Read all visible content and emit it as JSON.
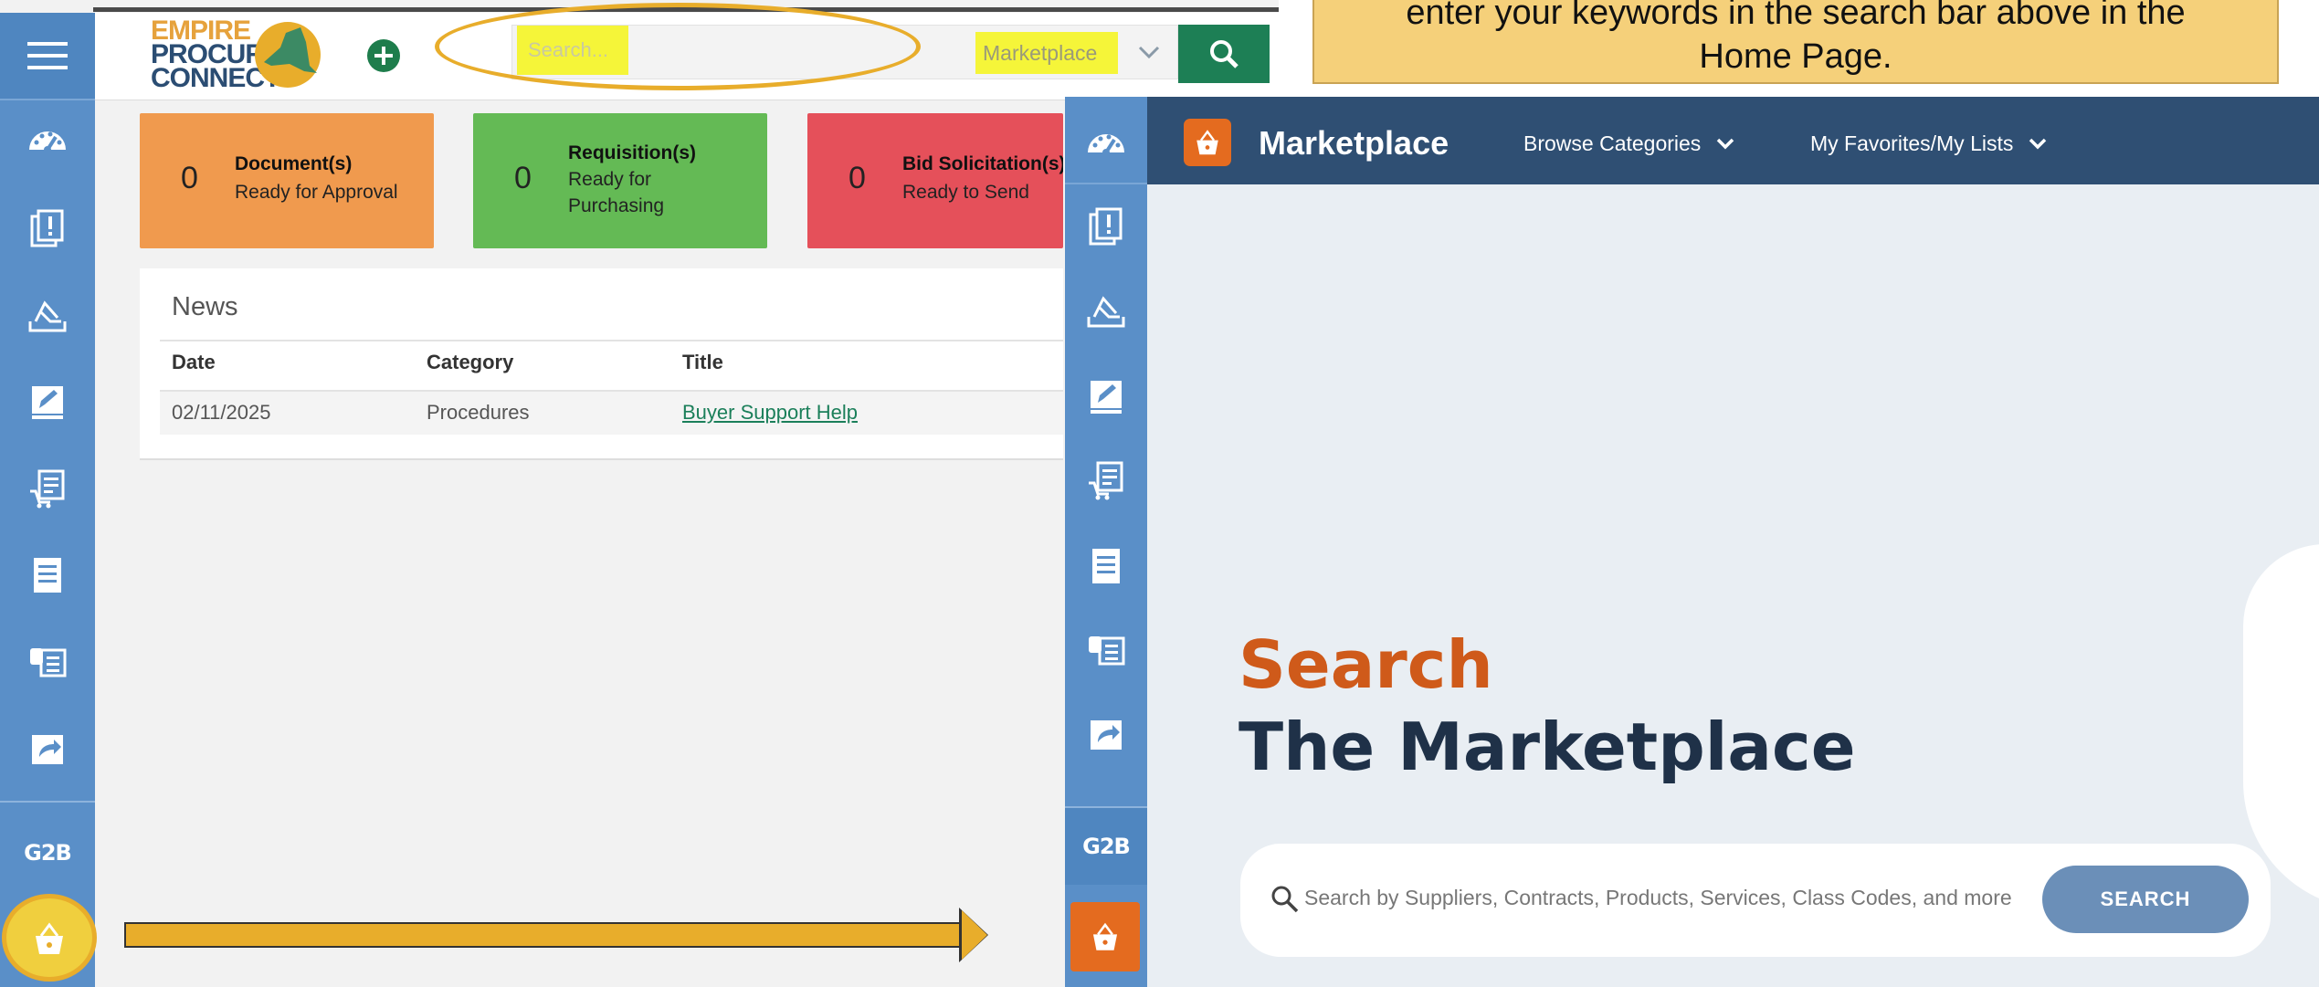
{
  "home": {
    "logo": {
      "line1": "EMPIRE",
      "line2": "PROCURE",
      "line3": "CONNECT"
    },
    "search": {
      "placeholder": "Search...",
      "scope": "Marketplace"
    },
    "cards": [
      {
        "count": "0",
        "title": "Document(s)",
        "sub": "Ready for Approval",
        "color": "#f09a4e"
      },
      {
        "count": "0",
        "title": "Requisition(s)",
        "sub": "Ready for Purchasing",
        "color": "#64ba55"
      },
      {
        "count": "0",
        "title": "Bid Solicitation(s)",
        "sub": "Ready to Send",
        "color": "#e5505a"
      }
    ],
    "news": {
      "title": "News",
      "headers": [
        "Date",
        "Category",
        "Title"
      ],
      "rows": [
        {
          "date": "02/11/2025",
          "category": "Procedures",
          "title": "Buyer Support Help"
        }
      ]
    },
    "sidebar": {
      "g2b": "G2B"
    }
  },
  "marketplace": {
    "title": "Marketplace",
    "nav": [
      "Browse Categories",
      "My Favorites/My Lists"
    ],
    "heading1": "Search",
    "heading2": "The Marketplace",
    "search_placeholder": "Search by Suppliers, Contracts, Products, Services, Class Codes, and more",
    "search_button": "SEARCH",
    "sidebar": {
      "g2b": "G2B"
    }
  },
  "callout": {
    "line1": "enter your keywords in the search bar above in the",
    "line2": "Home Page."
  },
  "colors": {
    "sidebar": "#5a8fc8",
    "header_dark": "#2f4f73",
    "accent_orange": "#e46b1f",
    "highlight": "#e8ad2b",
    "green": "#1d7f55"
  }
}
